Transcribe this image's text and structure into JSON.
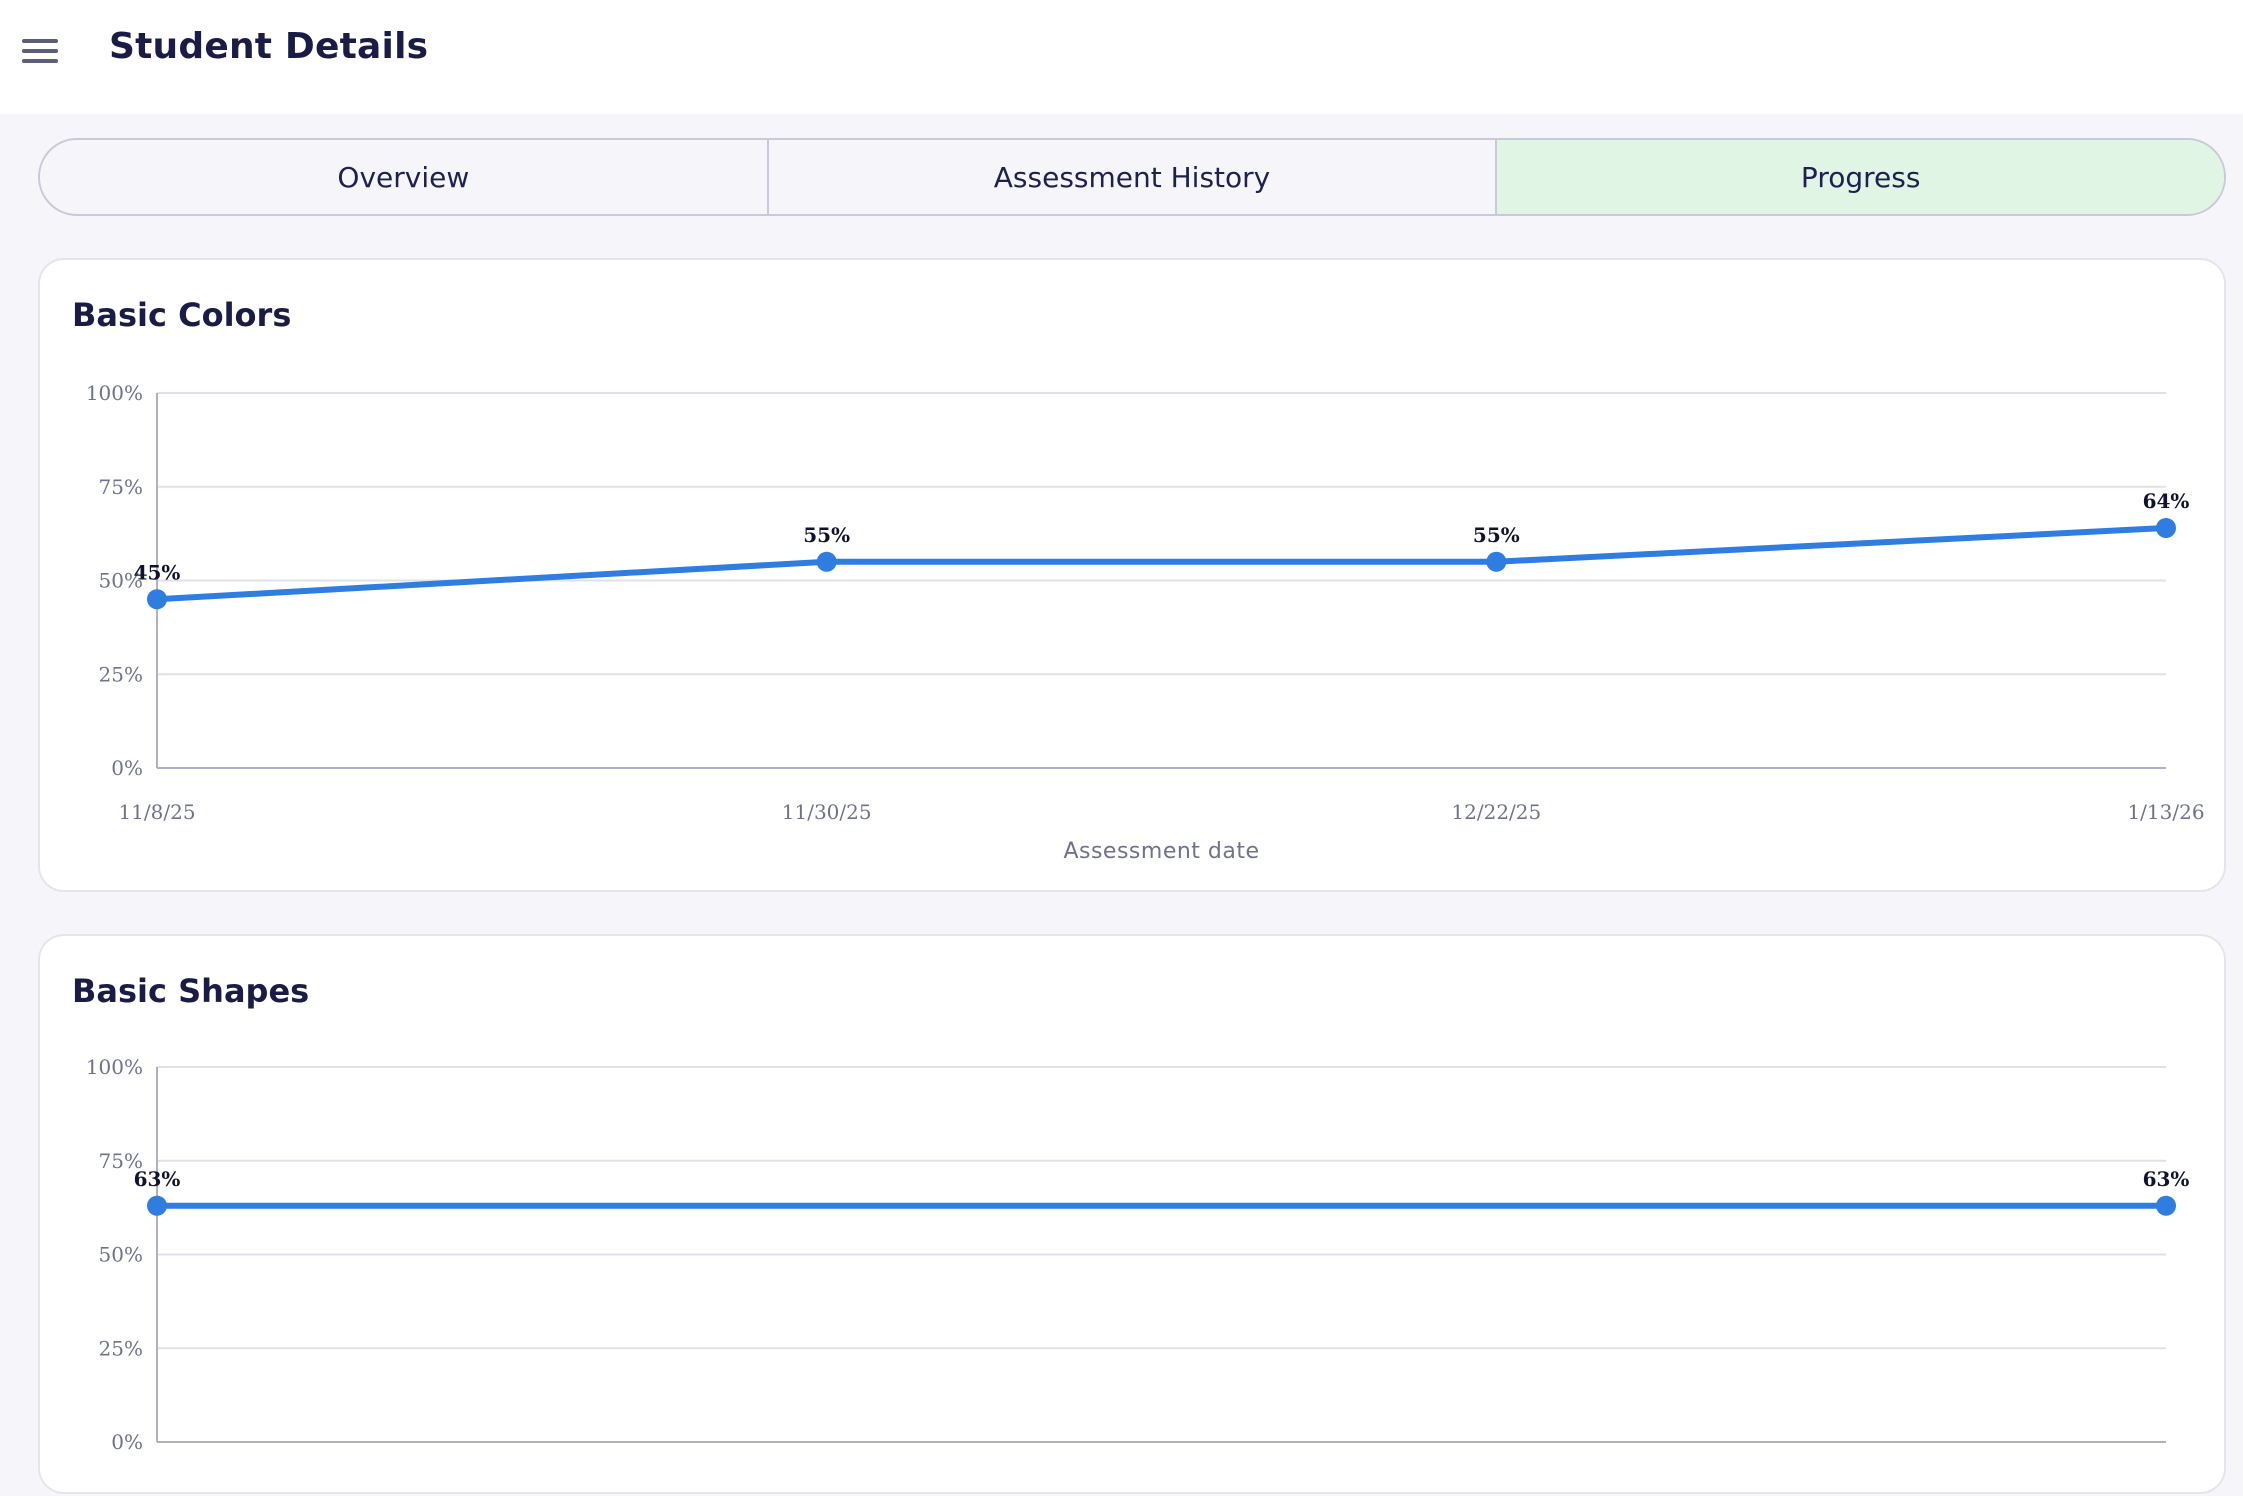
{
  "header": {
    "title": "Student Details",
    "menu_icon": "hamburger-menu-icon"
  },
  "tabs": [
    {
      "label": "Overview",
      "active": false
    },
    {
      "label": "Assessment History",
      "active": false
    },
    {
      "label": "Progress",
      "active": true
    }
  ],
  "colors": {
    "line": "#2f7de1",
    "active_tab": "#e1f5e4",
    "accent_text": "#1a1c46"
  },
  "chart_data": [
    {
      "type": "line",
      "title": "Basic Colors",
      "xlabel": "Assessment date",
      "ylabel": "",
      "x": [
        "11/8/25",
        "11/30/25",
        "12/22/25",
        "1/13/26"
      ],
      "series": [
        {
          "values": [
            45,
            55,
            55,
            64
          ]
        }
      ],
      "data_labels": [
        "45%",
        "55%",
        "55%",
        "64%"
      ],
      "yticks": [
        "0%",
        "25%",
        "50%",
        "75%",
        "100%"
      ],
      "ylim": [
        0,
        100
      ],
      "grid": true
    },
    {
      "type": "line",
      "title": "Basic Shapes",
      "xlabel": "",
      "ylabel": "",
      "x": [
        "",
        ""
      ],
      "series": [
        {
          "values": [
            63,
            63
          ]
        }
      ],
      "data_labels": [
        "63%",
        "63%"
      ],
      "yticks": [
        "0%",
        "25%",
        "50%",
        "75%",
        "100%"
      ],
      "ylim": [
        0,
        100
      ],
      "grid": true
    }
  ]
}
